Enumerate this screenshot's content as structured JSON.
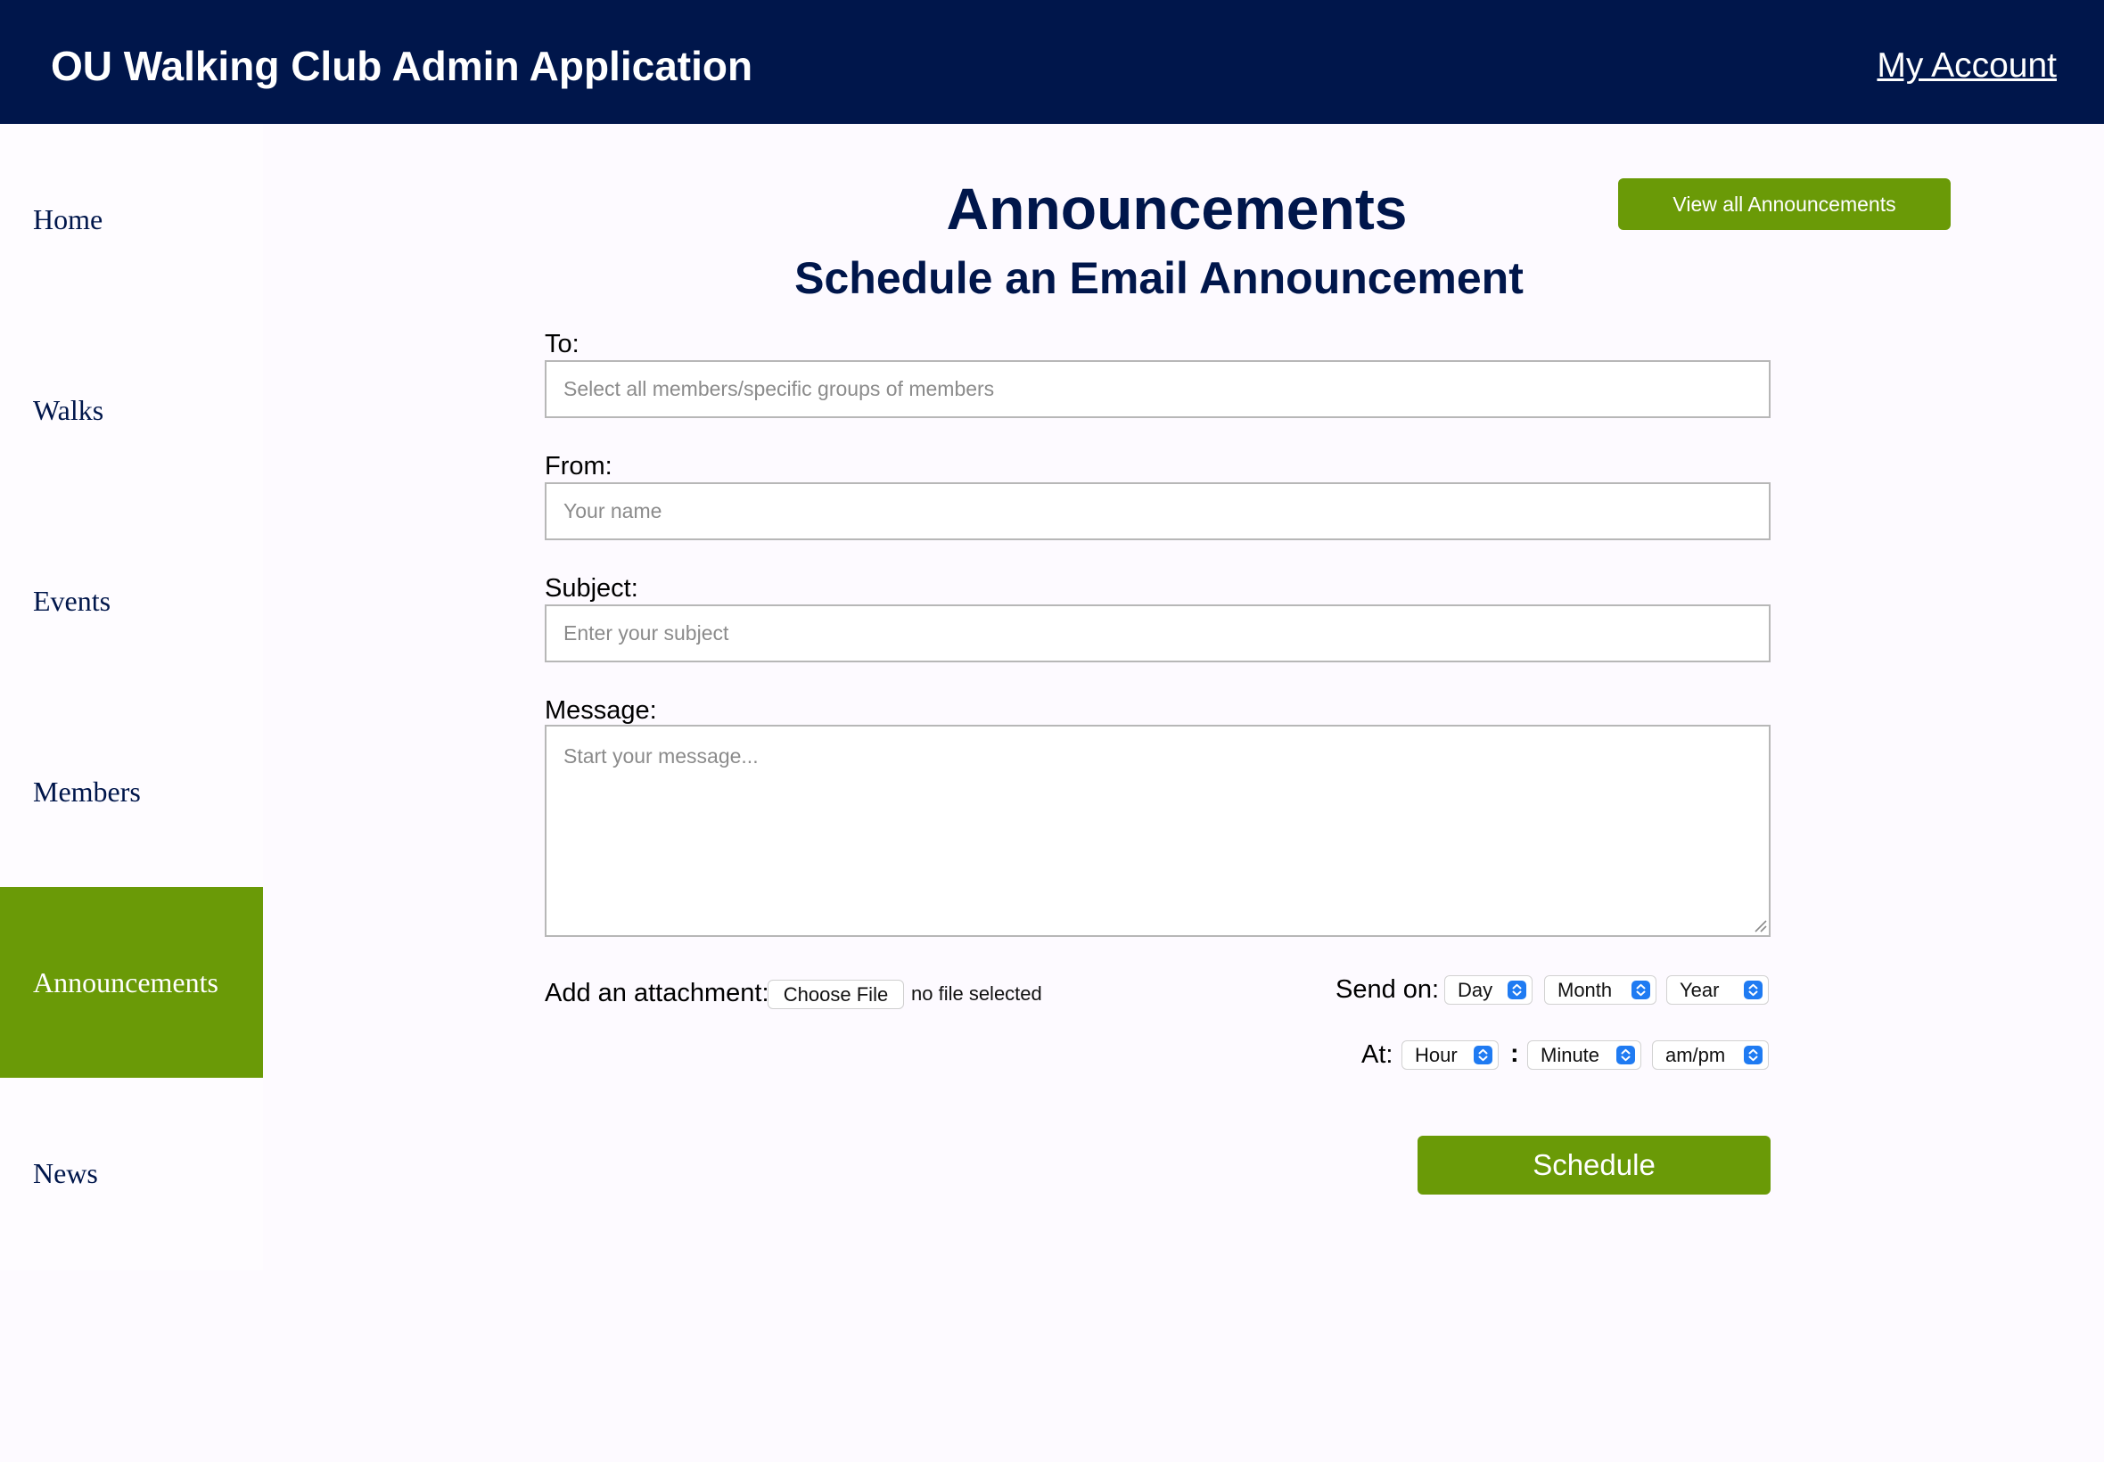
{
  "header": {
    "title": "OU Walking Club Admin Application",
    "account_link": "My Account"
  },
  "sidebar": {
    "items": [
      {
        "label": "Home",
        "active": false
      },
      {
        "label": "Walks",
        "active": false
      },
      {
        "label": "Events",
        "active": false
      },
      {
        "label": "Members",
        "active": false
      },
      {
        "label": "Announcements",
        "active": true
      },
      {
        "label": "News",
        "active": false
      }
    ]
  },
  "main": {
    "title": "Announcements",
    "subtitle": "Schedule an Email Announcement",
    "view_all_label": "View all Announcements",
    "form": {
      "to": {
        "label": "To:",
        "value": "",
        "placeholder": "Select all members/specific groups of members"
      },
      "from": {
        "label": "From:",
        "value": "",
        "placeholder": "Your name"
      },
      "subject": {
        "label": "Subject:",
        "value": "",
        "placeholder": "Enter your subject"
      },
      "message": {
        "label": "Message:",
        "value": "",
        "placeholder": "Start your message..."
      },
      "attachment": {
        "label": "Add an attachment:",
        "button_label": "Choose File",
        "status": "no file selected"
      },
      "send_on": {
        "label": "Send on:",
        "day": "Day",
        "month": "Month",
        "year": "Year"
      },
      "at": {
        "label": "At:",
        "separator": ":",
        "hour": "Hour",
        "minute": "Minute",
        "ampm": "am/pm"
      },
      "submit_label": "Schedule"
    }
  },
  "colors": {
    "header_bg": "#00164b",
    "accent_green": "#6a9a07",
    "page_bg": "#fdfaff",
    "select_arrow": "#1f7bf2"
  },
  "icons": {
    "select_arrow": "chevron-up-down-icon",
    "textarea_grip": "resize-grip-icon"
  }
}
